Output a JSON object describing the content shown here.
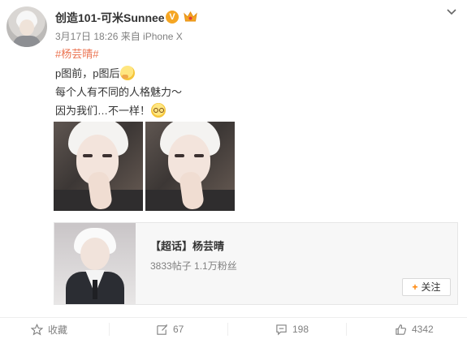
{
  "post": {
    "username": "创造101-可米Sunnee",
    "verified_badge": "V",
    "meta": "3月17日 18:26 来自 iPhone X",
    "topic": "#杨芸晴#",
    "line1": "p图前，p图后",
    "line2": "每个人有不同的人格魅力～",
    "line3": "因为我们…不一样！"
  },
  "card": {
    "title": "【超话】杨芸晴",
    "stats": "3833帖子 1.1万粉丝",
    "follow_label": "关注"
  },
  "actions": {
    "collect": "收藏",
    "repost": "67",
    "comment": "198",
    "like": "4342"
  },
  "colors": {
    "link": "#eb7350",
    "accent": "#ff8200",
    "muted": "#808080"
  },
  "icons": [
    "avatar",
    "verified-icon",
    "crown-icon",
    "chevron-down-icon",
    "thinking-emoji-icon",
    "dizzy-emoji-icon",
    "star-icon",
    "repost-icon",
    "comment-icon",
    "thumbs-up-icon",
    "plus-icon"
  ]
}
